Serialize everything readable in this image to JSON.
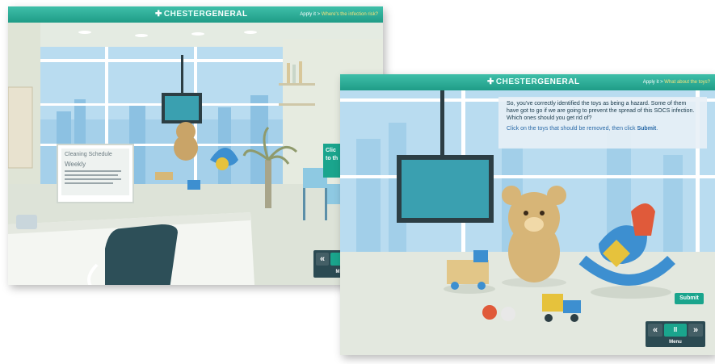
{
  "brand": {
    "plus": "✚",
    "part1": "CHESTER",
    "part2": "GENERAL"
  },
  "back_window": {
    "breadcrumb_prefix": "Apply it > ",
    "breadcrumb_link": "Where's the infection risk?",
    "monitor_title": "Cleaning Schedule",
    "monitor_subtitle": "Weekly",
    "callout_text": "Clic\nto th",
    "controls": {
      "prev": "«",
      "menu": "M"
    }
  },
  "front_window": {
    "breadcrumb_prefix": "Apply it > ",
    "breadcrumb_link": "What about the toys?",
    "dialog": {
      "text": "So, you've correctly identified the toys as being a hazard. Some of them have got to go if we are going to prevent the spread of this SOCS infection. Which ones should you get rid of?",
      "instruction_prefix": "Click on the toys that should be removed, then click ",
      "instruction_bold": "Submit",
      "instruction_suffix": "."
    },
    "submit_label": "Submit",
    "controls": {
      "prev": "«",
      "pause": "II",
      "next": "»",
      "menu": "Menu"
    }
  },
  "colors": {
    "header": "#2aa893",
    "accent": "#1aa58d",
    "dialog_text": "#1a3a4a",
    "instruction": "#2a6aa8",
    "control_bg": "#2b4a52"
  }
}
